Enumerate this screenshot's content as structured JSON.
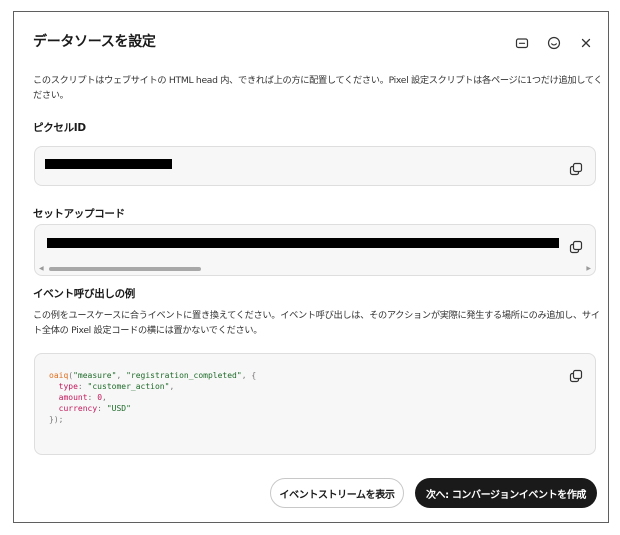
{
  "dialog": {
    "title": "データソースを設定",
    "icons": [
      "mail-icon",
      "smiley-icon",
      "close-icon"
    ]
  },
  "intro": "このスクリプトはウェブサイトの HTML head 内、できれば上の方に配置してください。Pixel 設定スクリプトは各ページに1つだけ追加してください。",
  "pixel": {
    "label": "ピクセルID",
    "value": "redacted",
    "copy_icon": "copy-icon"
  },
  "setup": {
    "label": "セットアップコード",
    "value": "redacted",
    "copy_icon": "copy-icon"
  },
  "event": {
    "label": "イベント呼び出しの例",
    "description": "この例をユースケースに合うイベントに置き換えてください。イベント呼び出しは、そのアクションが実際に発生する場所にのみ追加し、サイト全体の Pixel 設定コードの横には置かないでください。",
    "code": {
      "fn": "oaiq",
      "arg1": "\"measure\"",
      "arg2": "\"registration_completed\"",
      "k1": "type",
      "v1": "\"customer_action\"",
      "k2": "amount",
      "v2": "0",
      "k3": "currency",
      "v3": "\"USD\""
    }
  },
  "actions": {
    "secondary": "イベントストリームを表示",
    "primary": "次へ: コンバージョンイベントを作成"
  },
  "colors": {
    "primary_bg": "#1a1a1a",
    "code_fn": "#e07020",
    "code_string": "#1f6b2a",
    "code_key": "#c2185b"
  }
}
